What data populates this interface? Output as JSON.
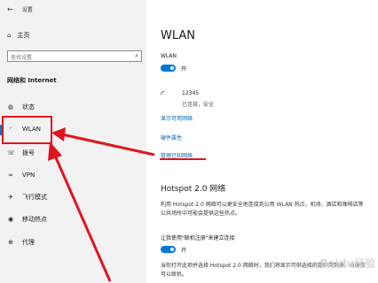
{
  "window": {
    "title": "设置"
  },
  "sidebar": {
    "home_label": "主页",
    "search_placeholder": "查找设置",
    "section_label": "网络和 Internet",
    "items": [
      {
        "label": "状态",
        "icon": "globe-icon"
      },
      {
        "label": "WLAN",
        "icon": "wifi-icon",
        "active": true
      },
      {
        "label": "拨号",
        "icon": "phone-icon"
      },
      {
        "label": "VPN",
        "icon": "vpn-icon"
      },
      {
        "label": "飞行模式",
        "icon": "airplane-icon"
      },
      {
        "label": "移动热点",
        "icon": "hotspot-icon"
      },
      {
        "label": "代理",
        "icon": "globe-icon"
      }
    ]
  },
  "main": {
    "title": "WLAN",
    "wlan_toggle": {
      "label": "WLAN",
      "state": "开"
    },
    "network": {
      "name": "12345",
      "status": "已连接，安全"
    },
    "links": {
      "show_available": "显示可用网络",
      "hardware_props": "硬件属性",
      "manage_known": "管理已知网络"
    },
    "hotspot": {
      "title": "Hotspot 2.0 网络",
      "description": "利用 Hotspot 2.0 网络可以更安全地连接到公用 WLAN 热点。机场、酒店和咖啡店等公共场所中可能会提供这些热点。",
      "toggle_label": "让我使用\"联机注册\"来建立连接",
      "toggle_state": "开",
      "note": "当你打开此项并选择 Hotspot 2.0 网络时，我们将显示可供选择的提供商列表，以便你可以联机。"
    }
  },
  "watermark": "Baidu经验",
  "colors": {
    "accent": "#0078d7",
    "annotation": "#e0141e",
    "link": "#0067b8"
  }
}
